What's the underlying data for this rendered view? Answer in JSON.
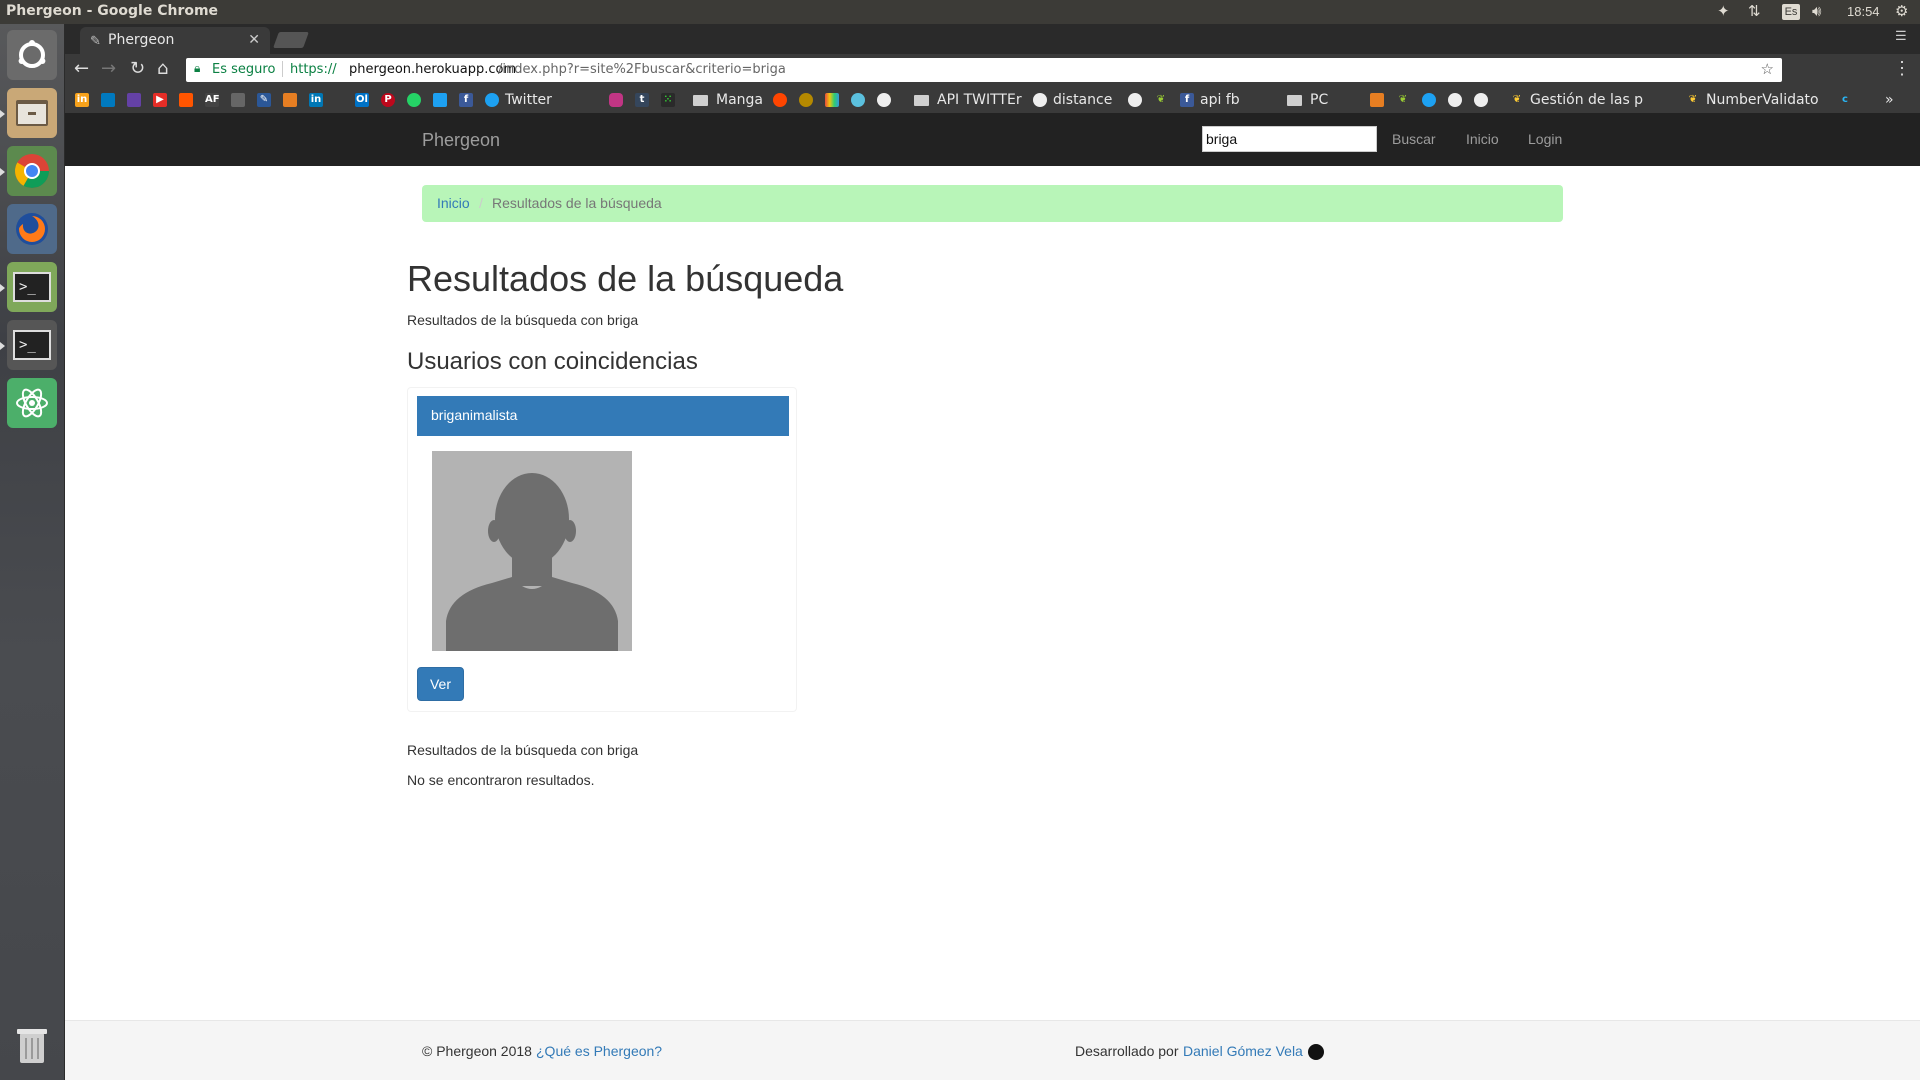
{
  "os": {
    "window_title": "Phergeon - Google Chrome",
    "lang": "Es",
    "clock": "18:54"
  },
  "browser": {
    "tab_title": "Phergeon",
    "secure_label": "Es seguro",
    "url_proto": "https://",
    "url_host": "phergeon.herokuapp.com",
    "url_path": "/index.php?r=site%2Fbuscar&criterio=briga",
    "bookmarks": {
      "twitter": "Twitter",
      "manga": "Manga",
      "api_twitter": "API TWITTEr",
      "distance": "distance",
      "api_fb": "api fb",
      "pc": "PC",
      "gestion": "Gestión de las p",
      "number_validator": "NumberValidato"
    }
  },
  "site": {
    "brand": "Phergeon",
    "search_value": "briga",
    "nav": {
      "buscar": "Buscar",
      "inicio": "Inicio",
      "login": "Login"
    }
  },
  "breadcrumb": {
    "home": "Inicio",
    "current": "Resultados de la búsqueda"
  },
  "main": {
    "title": "Resultados de la búsqueda",
    "subtitle": "Resultados de la búsqueda con briga",
    "users_heading": "Usuarios con coincidencias",
    "user_card": {
      "username": "briganimalista",
      "button": "Ver"
    },
    "subtitle2": "Resultados de la búsqueda con briga",
    "no_results": "No se encontraron resultados."
  },
  "footer": {
    "copyright": "© Phergeon 2018",
    "about_link": "¿Qué es Phergeon?",
    "dev_label": "Desarrollado por",
    "author": "Daniel Gómez Vela"
  }
}
